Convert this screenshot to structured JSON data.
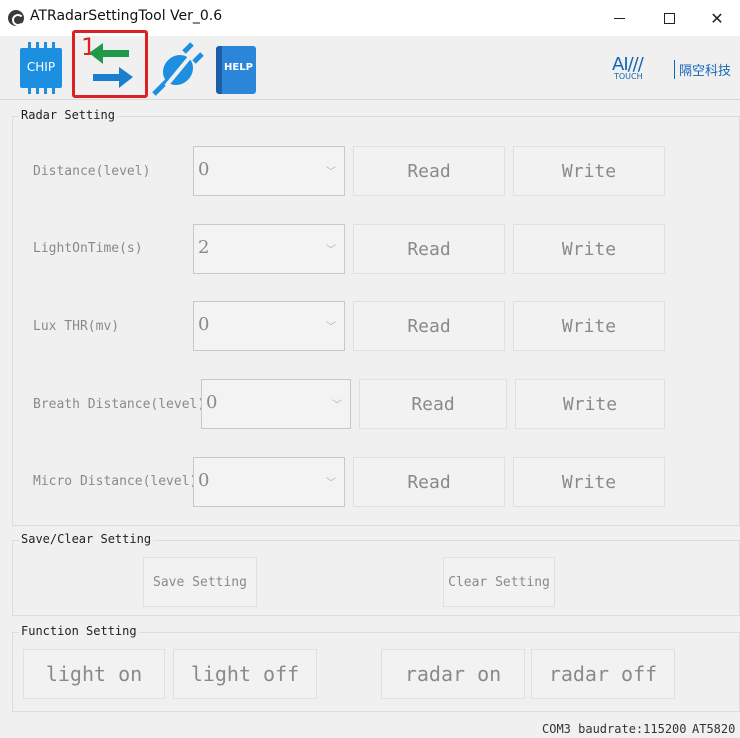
{
  "window": {
    "title": "ATRadarSettingTool Ver_0.6"
  },
  "toolbar": {
    "chip_label": "CHIP",
    "connect_badge": "1",
    "help_label": "HELP",
    "brand_logo": "AI///",
    "brand_sub": "TOUCH",
    "brand_cn": "隔空科技"
  },
  "radar": {
    "title": "Radar Setting",
    "read_label": "Read",
    "write_label": "Write",
    "rows": [
      {
        "label": "Distance(level)",
        "value": "0"
      },
      {
        "label": "LightOnTime(s)",
        "value": "2"
      },
      {
        "label": "Lux THR(mv)",
        "value": "0"
      },
      {
        "label": "Breath Distance(level)",
        "value": "0"
      },
      {
        "label": "Micro Distance(level)",
        "value": "0"
      }
    ]
  },
  "save_clear": {
    "title": "Save/Clear Setting",
    "save_label": "Save Setting",
    "clear_label": "Clear Setting"
  },
  "function": {
    "title": "Function Setting",
    "light_on": "light on",
    "light_off": "light off",
    "radar_on": "radar on",
    "radar_off": "radar off"
  },
  "status": {
    "port": "COM3 baudrate:115200",
    "model": "AT5820"
  }
}
